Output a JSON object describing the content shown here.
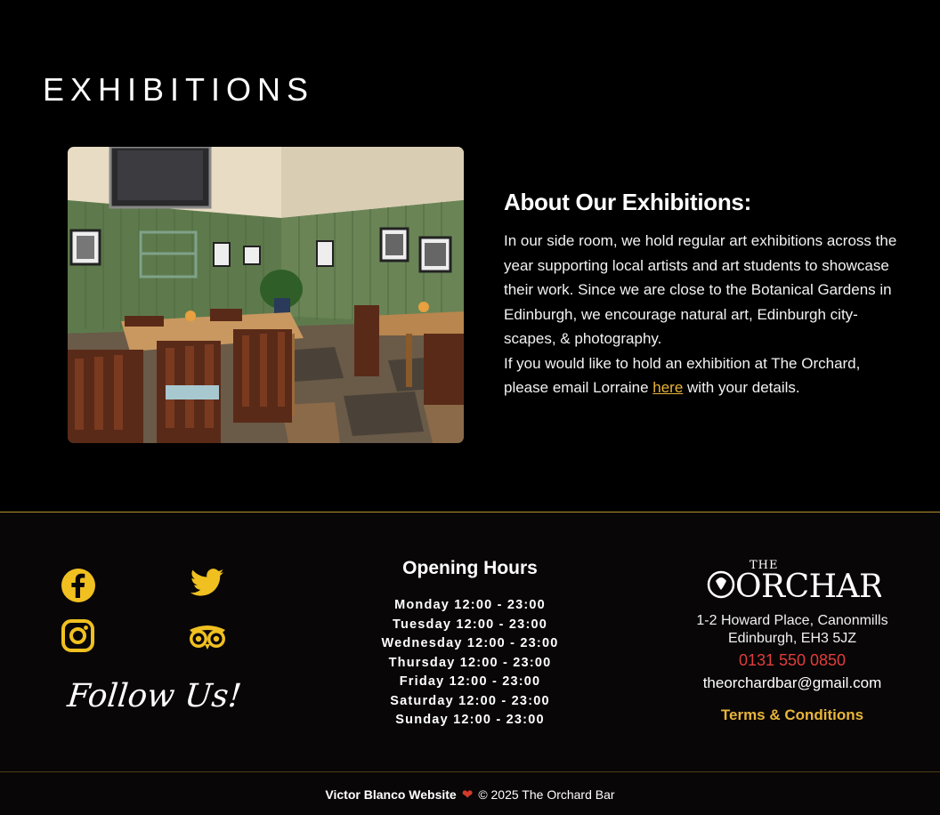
{
  "section": {
    "title": "EXHIBITIONS"
  },
  "about": {
    "heading": "About Our Exhibitions:",
    "para1": "In our side room, we hold regular art exhibitions across the year supporting local artists and art students to showcase their work. Since we are close to the Botanical Gardens in Edinburgh, we encourage natural art, Edinburgh city-scapes, & photography.",
    "para2_before": "If you would like to hold an exhibition at The Orchard, please email Lorraine ",
    "link_text": "here",
    "para2_after": " with your details."
  },
  "social": {
    "icons": [
      "facebook-icon",
      "twitter-icon",
      "instagram-icon",
      "tripadvisor-icon"
    ],
    "follow_text": "Follow Us!",
    "icon_color": "#f0c020"
  },
  "hours": {
    "title": "Opening Hours",
    "days": [
      "Monday 12:00 - 23:00",
      "Tuesday 12:00 - 23:00",
      "Wednesday 12:00 - 23:00",
      "Thursday 12:00 - 23:00",
      "Friday 12:00 - 23:00",
      "Saturday 12:00 - 23:00",
      "Sunday 12:00 - 23:00"
    ]
  },
  "contact": {
    "logo_small": "THE",
    "logo_big": "ORCHARD",
    "address_line1": "1-2 Howard Place, Canonmills",
    "address_line2": "Edinburgh, EH3 5JZ",
    "phone": "0131 550 0850",
    "email": "theorchardbar@gmail.com",
    "terms": "Terms & Conditions"
  },
  "credit": {
    "author": "Victor Blanco Website",
    "copyright": "© 2025 The Orchard Bar"
  },
  "colors": {
    "accent": "#e8b53a",
    "phone": "#e23d3a",
    "footer_border": "#b8902c"
  }
}
